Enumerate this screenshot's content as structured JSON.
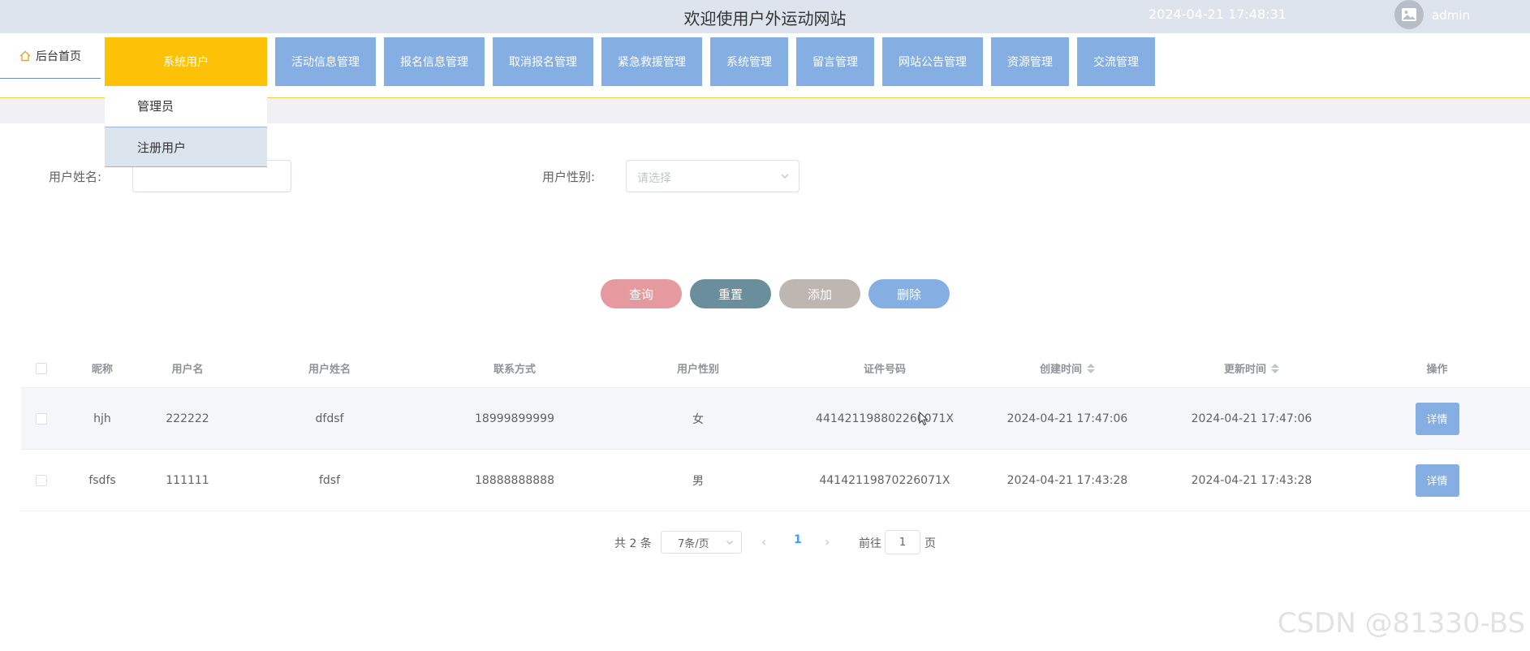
{
  "header": {
    "title": "欢迎使用户外运动网站",
    "datetime": "2024-04-21 17:48:31",
    "username": "admin"
  },
  "nav": {
    "home": "后台首页",
    "items": [
      {
        "label": "系统用户",
        "active": true
      },
      {
        "label": "活动信息管理"
      },
      {
        "label": "报名信息管理"
      },
      {
        "label": "取消报名管理"
      },
      {
        "label": "紧急救援管理"
      },
      {
        "label": "系统管理"
      },
      {
        "label": "留言管理"
      },
      {
        "label": "网站公告管理"
      },
      {
        "label": "资源管理"
      },
      {
        "label": "交流管理"
      }
    ],
    "dropdown": [
      {
        "label": "管理员"
      },
      {
        "label": "注册用户",
        "hover": true
      }
    ]
  },
  "search": {
    "name_label": "用户姓名:",
    "name_value": "",
    "gender_label": "用户性别:",
    "gender_placeholder": "请选择"
  },
  "buttons": {
    "query": "查询",
    "reset": "重置",
    "add": "添加",
    "delete": "删除"
  },
  "colors": {
    "query": "#e49a9e",
    "reset": "#6a8e9c",
    "add": "#bdb6b1",
    "delete": "#85aee2",
    "nav": "#85aee2",
    "nav_active": "#fdc207"
  },
  "table": {
    "headers": [
      "昵称",
      "用户名",
      "用户姓名",
      "联系方式",
      "用户性别",
      "证件号码",
      "创建时间",
      "更新时间",
      "操作"
    ],
    "rows": [
      [
        "hjh",
        "222222",
        "dfdsf",
        "18999899999",
        "女",
        "441421198802260071X",
        "2024-04-21 17:47:06",
        "2024-04-21 17:47:06"
      ],
      [
        "fsdfs",
        "111111",
        "fdsf",
        "18888888888",
        "男",
        "44142119870226071X",
        "2024-04-21 17:43:28",
        "2024-04-21 17:43:28"
      ]
    ],
    "detail_label": "详情"
  },
  "pagination": {
    "total": "共 2 条",
    "page_size": "7条/页",
    "current": "1",
    "goto_label": "前往",
    "goto_value": "1",
    "page_suffix": "页"
  },
  "watermark": "CSDN @81330-BS"
}
